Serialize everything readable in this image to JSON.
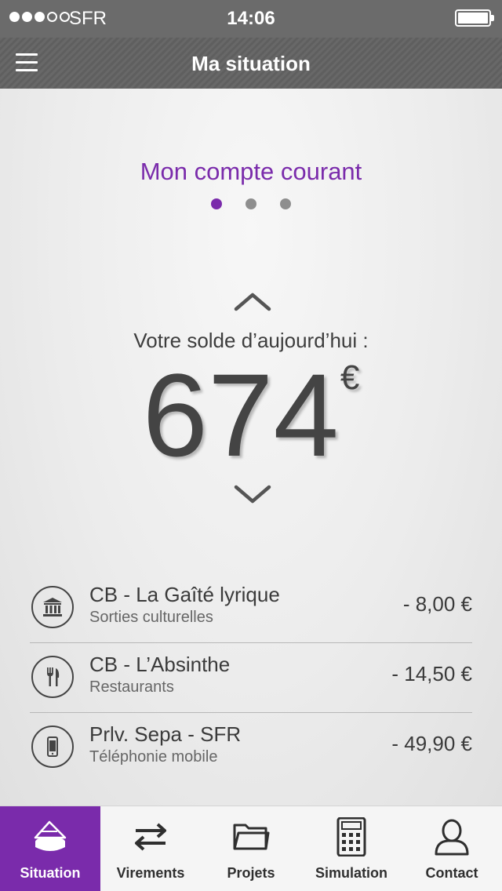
{
  "status_bar": {
    "carrier": "SFR",
    "time": "14:06"
  },
  "nav": {
    "title": "Ma situation"
  },
  "account": {
    "title": "Mon compte courant",
    "pages": 3,
    "active_page": 1
  },
  "balance": {
    "label": "Votre solde d’aujourd’hui :",
    "amount": "674",
    "currency": "€"
  },
  "transactions": [
    {
      "title": "CB - La Gaîté lyrique",
      "category": "Sorties culturelles",
      "amount": "- 8,00 €",
      "icon": "museum-icon"
    },
    {
      "title": "CB - L’Absinthe",
      "category": "Restaurants",
      "amount": "- 14,50 €",
      "icon": "fork-knife-icon"
    },
    {
      "title": "Prlv. Sepa - SFR",
      "category": "Téléphonie mobile",
      "amount": "- 49,90 €",
      "icon": "mobile-phone-icon"
    }
  ],
  "tabs": [
    {
      "label": "Situation",
      "icon": "situation-icon",
      "active": true
    },
    {
      "label": "Virements",
      "icon": "transfer-arrows-icon",
      "active": false
    },
    {
      "label": "Projets",
      "icon": "folder-icon",
      "active": false
    },
    {
      "label": "Simulation",
      "icon": "calculator-icon",
      "active": false
    },
    {
      "label": "Contact",
      "icon": "person-icon",
      "active": false
    }
  ],
  "colors": {
    "accent": "#7a2bab",
    "header": "#666666"
  }
}
